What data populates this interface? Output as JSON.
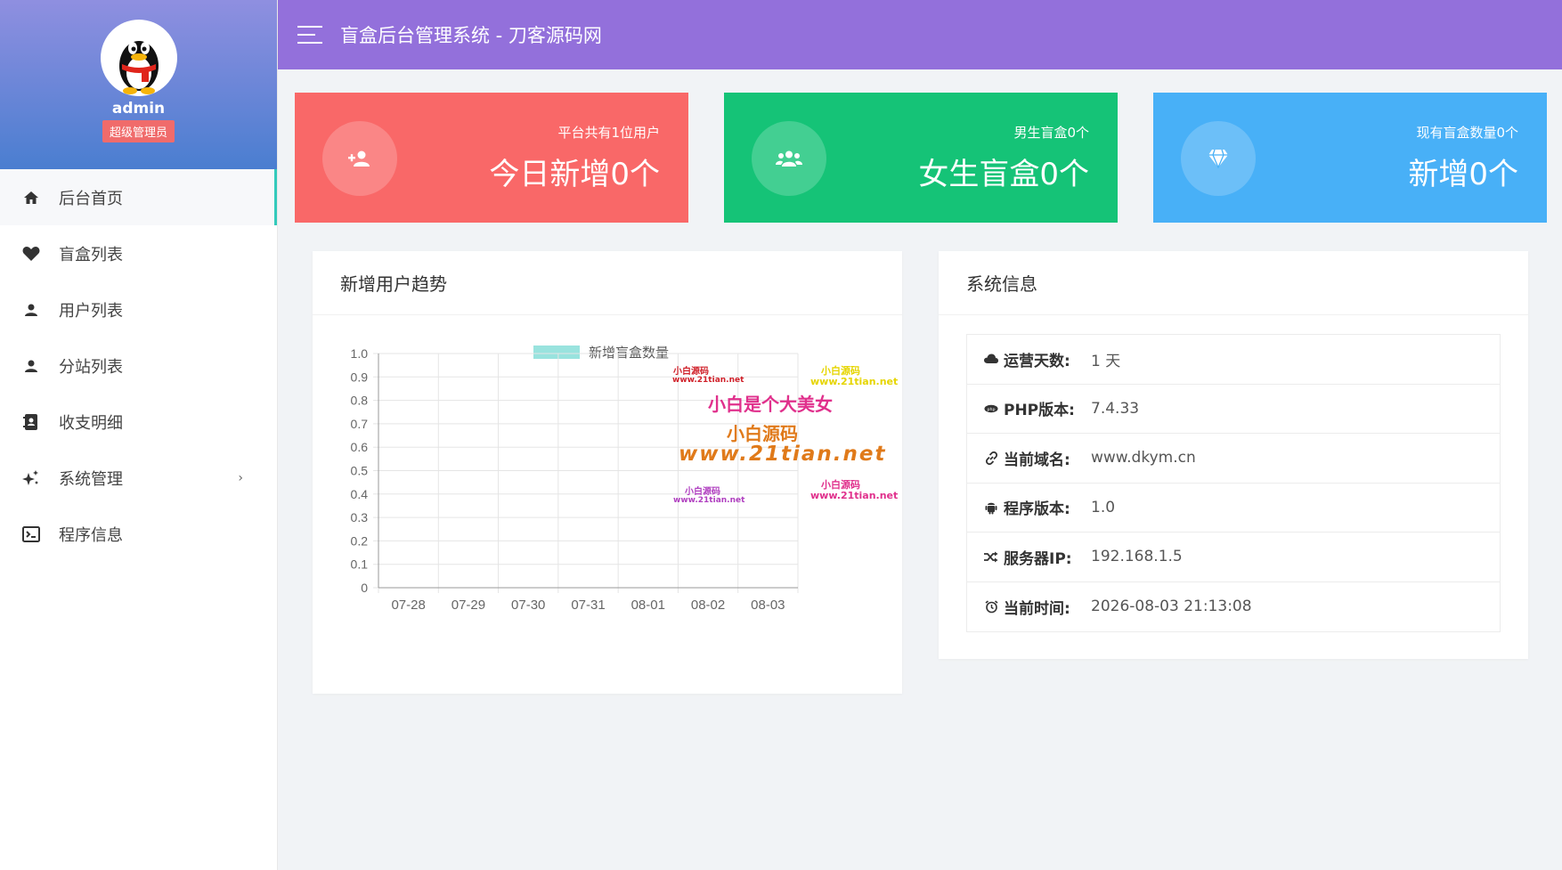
{
  "profile": {
    "name": "admin",
    "role": "超级管理员"
  },
  "sidebar": {
    "items": [
      {
        "label": "后台首页",
        "icon": "home-icon"
      },
      {
        "label": "盲盒列表",
        "icon": "heart-icon"
      },
      {
        "label": "用户列表",
        "icon": "user-icon"
      },
      {
        "label": "分站列表",
        "icon": "user-icon"
      },
      {
        "label": "收支明细",
        "icon": "contacts-icon"
      },
      {
        "label": "系统管理",
        "icon": "sparkles-icon"
      },
      {
        "label": "程序信息",
        "icon": "console-icon"
      }
    ],
    "chevron": "›"
  },
  "header": {
    "title": "盲盒后台管理系统 - 刀客源码网"
  },
  "cards": [
    {
      "sub": "平台共有1位用户",
      "big": "今日新增0个",
      "color": "#f96868",
      "icon": "user-plus-icon"
    },
    {
      "sub": "男生盲盒0个",
      "big": "女生盲盒0个",
      "color": "#15c377",
      "icon": "users-icon"
    },
    {
      "sub": "现有盲盒数量0个",
      "big": "新增0个",
      "color": "#48b0f7",
      "icon": "diamond-icon"
    }
  ],
  "chart_panel": {
    "title": "新增用户趋势"
  },
  "chart_data": {
    "type": "bar",
    "categories": [
      "07-28",
      "07-29",
      "07-30",
      "07-31",
      "08-01",
      "08-02",
      "08-03"
    ],
    "series": [
      {
        "name": "新增盲盒数量",
        "values": [
          0,
          0,
          0,
          0,
          0,
          0,
          0
        ],
        "color": "#99e3de"
      }
    ],
    "y_ticks": [
      "1.0",
      "0.9",
      "0.8",
      "0.7",
      "0.6",
      "0.5",
      "0.4",
      "0.3",
      "0.2",
      "0.1",
      "0"
    ],
    "ylim": [
      0,
      1
    ],
    "grid": true,
    "legend": "top"
  },
  "watermark": {
    "small_name_1": "小白源码",
    "small_url_1": "www.21tian.net",
    "small_name_2": "小白源码",
    "small_url_2": "www.21tian.net",
    "headline": "小白是个大美女",
    "brand": "小白源码",
    "url": "www.21tian.net",
    "small_name_3": "小白源码",
    "small_url_3": "www.21tian.net",
    "small_name_4": "小白源码",
    "small_url_4": "www.21tian.net"
  },
  "sys_panel": {
    "title": "系统信息",
    "rows": [
      {
        "key": "运营天数:",
        "value": "1 天",
        "icon": "cloud-icon"
      },
      {
        "key": "PHP版本:",
        "value": "7.4.33",
        "icon": "php-icon"
      },
      {
        "key": "当前域名:",
        "value": "www.dkym.cn",
        "icon": "link-icon"
      },
      {
        "key": "程序版本:",
        "value": "1.0",
        "icon": "android-icon"
      },
      {
        "key": "服务器IP:",
        "value": "192.168.1.5",
        "icon": "shuffle-icon"
      },
      {
        "key": "当前时间:",
        "value": "2026-08-03 21:13:08",
        "icon": "alarm-icon"
      }
    ]
  }
}
